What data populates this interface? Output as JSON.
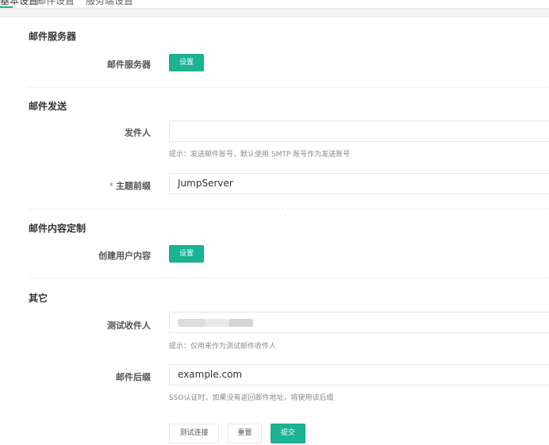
{
  "tabs": [
    "基本设置",
    "邮件设置",
    "服务端设置"
  ],
  "accent_color": "#1ab394",
  "sections": {
    "mail_server": {
      "title": "邮件服务器",
      "label": "邮件服务器",
      "button": "设置"
    },
    "mail_send": {
      "title": "邮件发送",
      "sender_label": "发件人",
      "sender_value": "",
      "sender_help": "提示：发送邮件账号，默认使用 SMTP 账号作为发送账号",
      "subject_prefix_required": "*",
      "subject_prefix_label": "主题前缀",
      "subject_prefix_value": "JumpServer"
    },
    "mail_content": {
      "title": "邮件内容定制",
      "create_user_label": "创建用户内容",
      "button": "设置"
    },
    "other": {
      "title": "其它",
      "test_recipient_label": "测试收件人",
      "test_recipient_help": "提示：仅用来作为测试邮件收件人",
      "mail_suffix_label": "邮件后缀",
      "mail_suffix_value": "example.com",
      "mail_suffix_help": "SSO认证时，如果没有返回邮件地址，将使用该后缀"
    }
  },
  "actions": {
    "test_connection": "测试连接",
    "reset": "重置",
    "submit": "提交"
  }
}
